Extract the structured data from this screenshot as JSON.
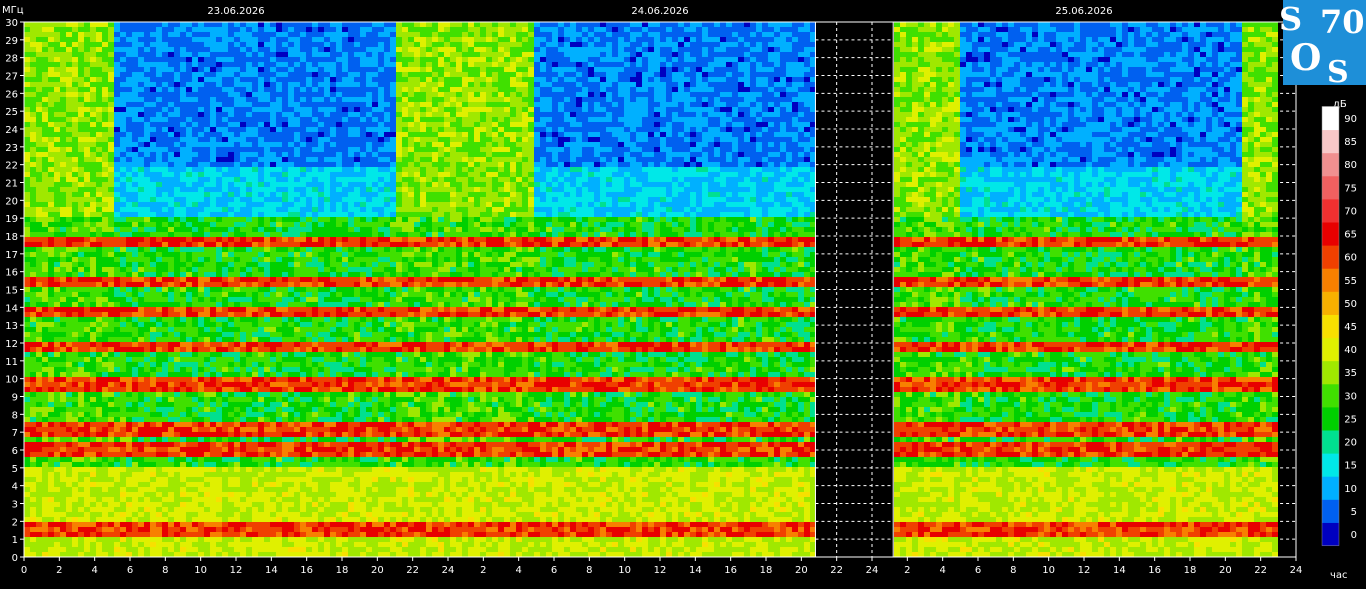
{
  "chart_data": {
    "type": "heatmap",
    "title": "",
    "ylabel": "МГц",
    "xlabel": "час",
    "dates": [
      "23.06.2026",
      "24.06.2026",
      "25.06.2026"
    ],
    "ylim": [
      0,
      30
    ],
    "y_ticks": [
      0,
      1,
      2,
      3,
      4,
      5,
      6,
      7,
      8,
      9,
      10,
      11,
      12,
      13,
      14,
      15,
      16,
      17,
      18,
      19,
      20,
      21,
      22,
      23,
      24,
      25,
      26,
      27,
      28,
      29,
      30
    ],
    "x_tick_labels": [
      "0",
      "2",
      "4",
      "6",
      "8",
      "10",
      "12",
      "14",
      "16",
      "18",
      "20",
      "22",
      "24",
      "2",
      "4",
      "6",
      "8",
      "10",
      "12",
      "14",
      "16",
      "18",
      "20",
      "22",
      "24",
      "2",
      "4",
      "6",
      "8",
      "10",
      "12",
      "14",
      "16",
      "18",
      "20",
      "22",
      "24"
    ],
    "x_unit": "hours",
    "x_range_hours": [
      0,
      72
    ],
    "data_coverage_hours": [
      [
        0,
        44.8
      ],
      [
        49.2,
        71.1
      ]
    ],
    "strong_bands_mhz": [
      1.5,
      6.0,
      7.2,
      9.7,
      11.8,
      13.7,
      15.4,
      17.7
    ],
    "colorbar": {
      "unit": "дБ",
      "ticks": [
        0,
        5,
        10,
        15,
        20,
        25,
        30,
        35,
        40,
        45,
        50,
        55,
        60,
        65,
        70,
        75,
        80,
        85,
        90
      ],
      "colors": [
        "#0000c0",
        "#0060f0",
        "#00b0ff",
        "#00e8e8",
        "#00e090",
        "#00d000",
        "#40e000",
        "#a0e800",
        "#e0f000",
        "#f8e000",
        "#f8b000",
        "#f88000",
        "#f04000",
        "#e80000",
        "#f03030",
        "#f06060",
        "#f09090",
        "#f8c8c8",
        "#ffffff"
      ]
    }
  },
  "logo": {
    "text_s1": "S",
    "text_70": "70",
    "text_o": "O",
    "text_s2": "S"
  }
}
